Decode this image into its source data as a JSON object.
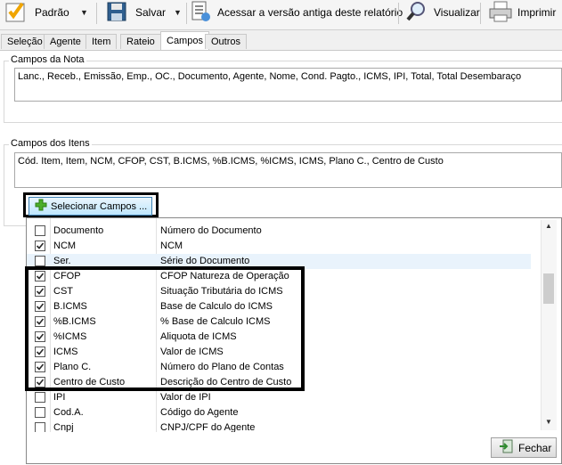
{
  "toolbar": {
    "padrao": "Padrão",
    "salvar": "Salvar",
    "antiga": "Acessar a versão antiga deste relatório",
    "visualizar": "Visualizar",
    "imprimir": "Imprimir"
  },
  "tabs": [
    "Seleção",
    "Agente",
    "Item",
    "Rateio",
    "Campos",
    "Outros"
  ],
  "active_tab": "Campos",
  "nota": {
    "title": "Campos da Nota",
    "value": "Lanc., Receb., Emissão, Emp., OC., Documento, Agente, Nome, Cond. Pagto., ICMS, IPI, Total, Total Desembaraço"
  },
  "itens": {
    "title": "Campos dos Itens",
    "value": "Cód. Item, Item, NCM, CFOP, CST, B.ICMS, %B.ICMS, %ICMS, ICMS, Plano C., Centro de Custo"
  },
  "select_button": "Selecionar Campos ...",
  "fechar_button": "Fechar",
  "rows": [
    {
      "field": "Documento",
      "desc": "Número do Documento",
      "checked": false
    },
    {
      "field": "NCM",
      "desc": "NCM",
      "checked": true
    },
    {
      "field": "Ser.",
      "desc": "Série do Documento",
      "checked": false
    },
    {
      "field": "CFOP",
      "desc": "CFOP Natureza de Operação",
      "checked": true
    },
    {
      "field": "CST",
      "desc": "Situação Tributária do ICMS",
      "checked": true
    },
    {
      "field": "B.ICMS",
      "desc": "Base de Calculo do ICMS",
      "checked": true
    },
    {
      "field": "%B.ICMS",
      "desc": "% Base de Calculo ICMS",
      "checked": true
    },
    {
      "field": "%ICMS",
      "desc": "Aliquota de ICMS",
      "checked": true
    },
    {
      "field": "ICMS",
      "desc": "Valor de ICMS",
      "checked": true
    },
    {
      "field": "Plano C.",
      "desc": "Número do Plano de Contas",
      "checked": true
    },
    {
      "field": "Centro de Custo",
      "desc": "Descrição do Centro de Custo",
      "checked": true
    },
    {
      "field": "IPI",
      "desc": "Valor de IPI",
      "checked": false
    },
    {
      "field": "Cod.A.",
      "desc": "Código do Agente",
      "checked": false
    },
    {
      "field": "Cnpj",
      "desc": "CNPJ/CPF do Agente",
      "checked": false
    }
  ]
}
